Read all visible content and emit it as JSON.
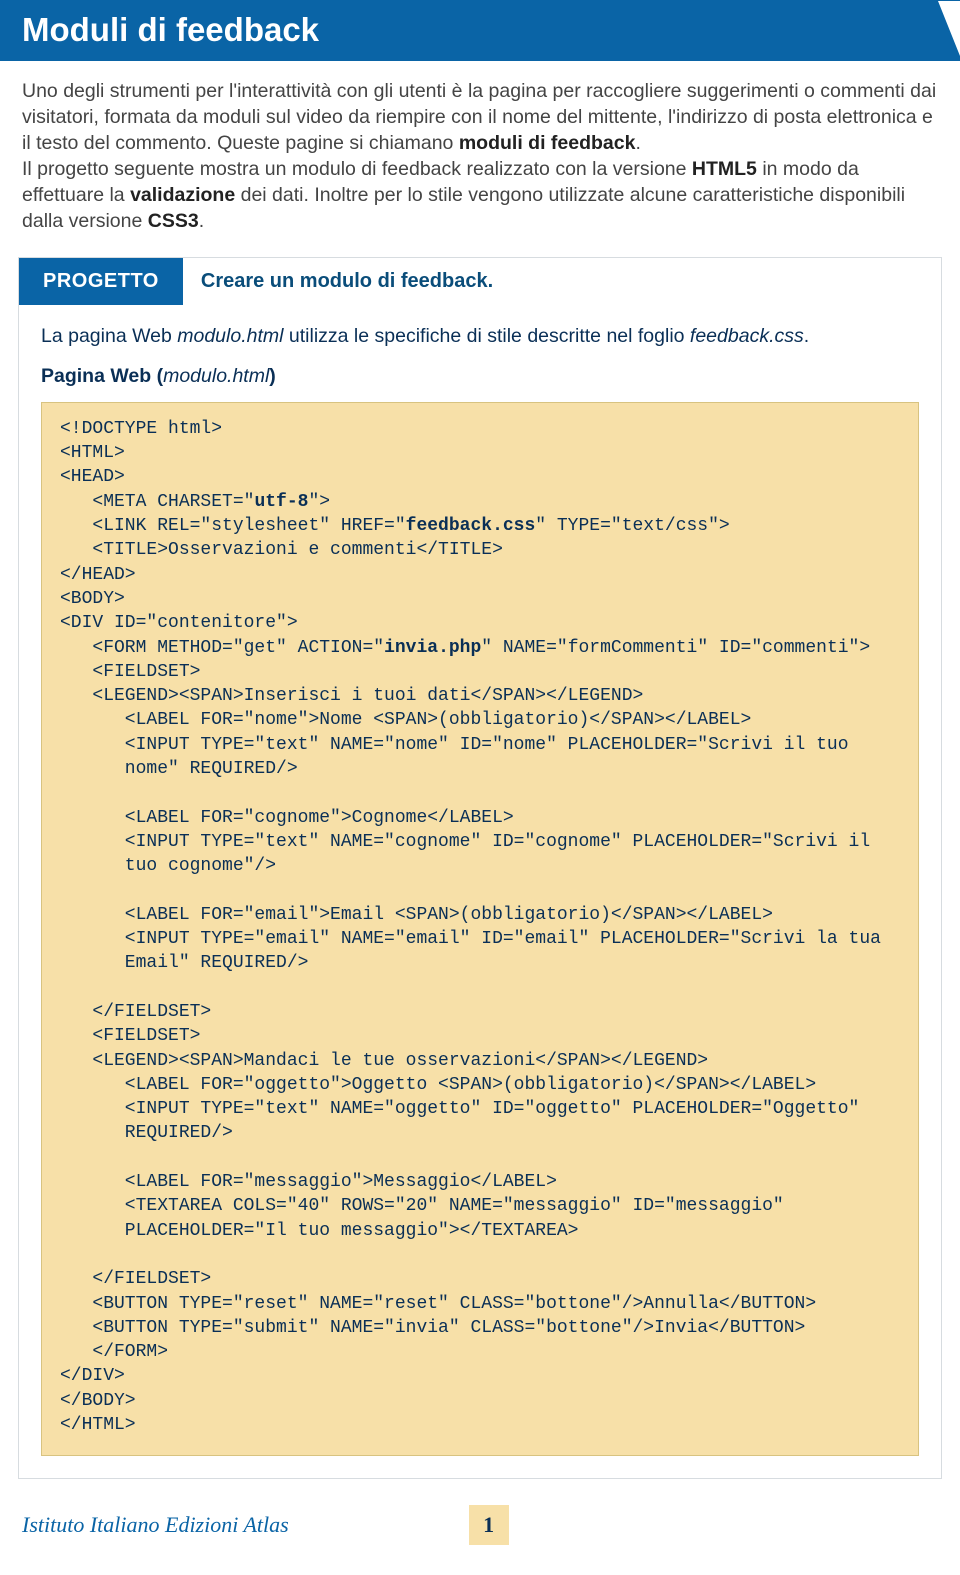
{
  "header": {
    "title": "Moduli di feedback"
  },
  "intro": {
    "p1a": "Uno degli strumenti per l'interattività con gli utenti è la pagina per raccogliere suggerimenti o commenti dai visitatori, formata da moduli sul video da riempire con il nome del mittente, l'indirizzo di posta elettronica e il testo del commento. Queste pagine si chiamano ",
    "p1b": "moduli di feedback",
    "p1c": ".",
    "p2a": "Il progetto seguente mostra un modulo di feedback realizzato con la versione ",
    "p2b": "HTML5",
    "p2c": " in modo da effettuare la ",
    "p2d": "validazione",
    "p2e": " dei dati. Inoltre per lo stile vengono utilizzate alcune caratteristiche disponibili dalla versione ",
    "p2f": "CSS3",
    "p2g": "."
  },
  "progetto": {
    "tag": "PROGETTO",
    "title": "Creare un modulo di feedback.",
    "desc_a": "La pagina Web ",
    "desc_b": "modulo.html",
    "desc_c": " utilizza le specifiche di stile descritte nel foglio ",
    "desc_d": "feedback.css",
    "desc_e": ".",
    "sub_a": "Pagina Web (",
    "sub_b": "modulo.html",
    "sub_c": ")"
  },
  "code": {
    "l01": "<!DOCTYPE html>",
    "l02": "<HTML>",
    "l03": "<HEAD>",
    "l04a": "   <META CHARSET=\"",
    "l04b": "utf-8",
    "l04c": "\">",
    "l05a": "   <LINK REL=\"stylesheet\" HREF=\"",
    "l05b": "feedback.css",
    "l05c": "\" TYPE=\"text/css\">",
    "l06": "   <TITLE>Osservazioni e commenti</TITLE>",
    "l07": "</HEAD>",
    "l08": "<BODY>",
    "l09": "<DIV ID=\"contenitore\">",
    "l10a": "   <FORM METHOD=\"get\" ACTION=\"",
    "l10b": "invia.php",
    "l10c": "\" NAME=\"formCommenti\" ID=\"commenti\">",
    "l11": "   <FIELDSET>",
    "l12": "   <LEGEND><SPAN>Inserisci i tuoi dati</SPAN></LEGEND>",
    "l13": "      <LABEL FOR=\"nome\">Nome <SPAN>(obbligatorio)</SPAN></LABEL>",
    "l14": "      <INPUT TYPE=\"text\" NAME=\"nome\" ID=\"nome\" PLACEHOLDER=\"Scrivi il tuo",
    "l15": "      nome\" REQUIRED/>",
    "blank1": "",
    "l16": "      <LABEL FOR=\"cognome\">Cognome</LABEL>",
    "l17": "      <INPUT TYPE=\"text\" NAME=\"cognome\" ID=\"cognome\" PLACEHOLDER=\"Scrivi il",
    "l18": "      tuo cognome\"/>",
    "blank2": "",
    "l19": "      <LABEL FOR=\"email\">Email <SPAN>(obbligatorio)</SPAN></LABEL>",
    "l20": "      <INPUT TYPE=\"email\" NAME=\"email\" ID=\"email\" PLACEHOLDER=\"Scrivi la tua",
    "l21": "      Email\" REQUIRED/>",
    "blank3": "",
    "l22": "   </FIELDSET>",
    "l23": "   <FIELDSET>",
    "l24": "   <LEGEND><SPAN>Mandaci le tue osservazioni</SPAN></LEGEND>",
    "l25": "      <LABEL FOR=\"oggetto\">Oggetto <SPAN>(obbligatorio)</SPAN></LABEL>",
    "l26": "      <INPUT TYPE=\"text\" NAME=\"oggetto\" ID=\"oggetto\" PLACEHOLDER=\"Oggetto\"",
    "l27": "      REQUIRED/>",
    "blank4": "",
    "l28": "      <LABEL FOR=\"messaggio\">Messaggio</LABEL>",
    "l29": "      <TEXTAREA COLS=\"40\" ROWS=\"20\" NAME=\"messaggio\" ID=\"messaggio\"",
    "l30": "      PLACEHOLDER=\"Il tuo messaggio\"></TEXTAREA>",
    "blank5": "",
    "l31": "   </FIELDSET>",
    "l32": "   <BUTTON TYPE=\"reset\" NAME=\"reset\" CLASS=\"bottone\"/>Annulla</BUTTON>",
    "l33": "   <BUTTON TYPE=\"submit\" NAME=\"invia\" CLASS=\"bottone\"/>Invia</BUTTON>",
    "l34": "   </FORM>",
    "l35": "</DIV>",
    "l36": "</BODY>",
    "l37": "</HTML>"
  },
  "footer": {
    "brand": "Istituto Italiano Edizioni Atlas",
    "page": "1"
  }
}
